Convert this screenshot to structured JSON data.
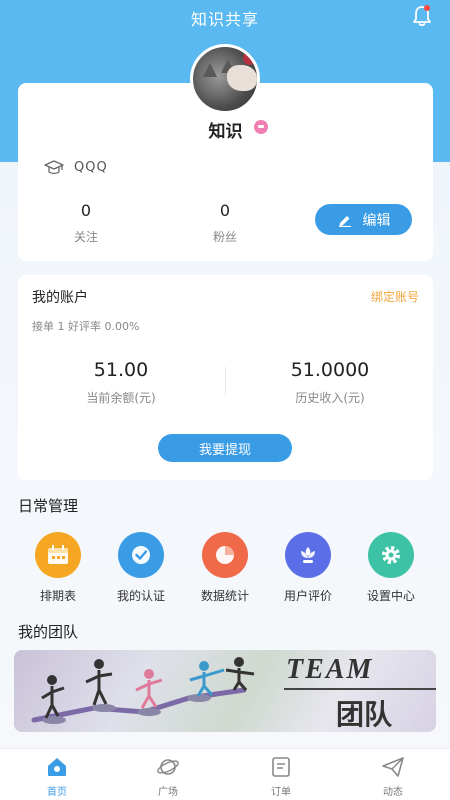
{
  "header": {
    "title": "知识共享",
    "bell_icon": "bell-icon",
    "background_color": "#5ab9f0"
  },
  "profile": {
    "avatar": "avatar-cat-photo",
    "name": "知识",
    "badge_icon": "chat-bubble-icon",
    "school_icon": "graduation-cap-icon",
    "school": "QQQ",
    "stats": [
      {
        "value": "0",
        "label": "关注"
      },
      {
        "value": "0",
        "label": "粉丝"
      }
    ],
    "edit_label": "编辑"
  },
  "account": {
    "title": "我的账户",
    "bind_label": "绑定账号",
    "summary": "接单 1  好评率 0.00%",
    "balance": {
      "value": "51.00",
      "label": "当前余额(元)"
    },
    "income": {
      "value": "51.0000",
      "label": "历史收入(元)"
    },
    "withdraw_label": "我要提现"
  },
  "daily": {
    "title": "日常管理",
    "items": [
      {
        "label": "排期表",
        "icon": "calendar-icon",
        "color": "#f5a623"
      },
      {
        "label": "我的认证",
        "icon": "verified-check-icon",
        "color": "#3b9ce6"
      },
      {
        "label": "数据统计",
        "icon": "pie-chart-icon",
        "color": "#f06a4a"
      },
      {
        "label": "用户评价",
        "icon": "flower-icon",
        "color": "#5b6ee8"
      },
      {
        "label": "设置中心",
        "icon": "gear-icon",
        "color": "#3ec2a6"
      }
    ]
  },
  "team": {
    "title": "我的团队",
    "banner_en": "TEAM",
    "banner_cn": "团队"
  },
  "tabbar": {
    "items": [
      {
        "label": "首页",
        "icon": "home-icon",
        "active": true
      },
      {
        "label": "广场",
        "icon": "planet-icon",
        "active": false
      },
      {
        "label": "订单",
        "icon": "order-list-icon",
        "active": false
      },
      {
        "label": "动态",
        "icon": "paper-plane-icon",
        "active": false
      }
    ],
    "active_color": "#3b9ce6"
  }
}
